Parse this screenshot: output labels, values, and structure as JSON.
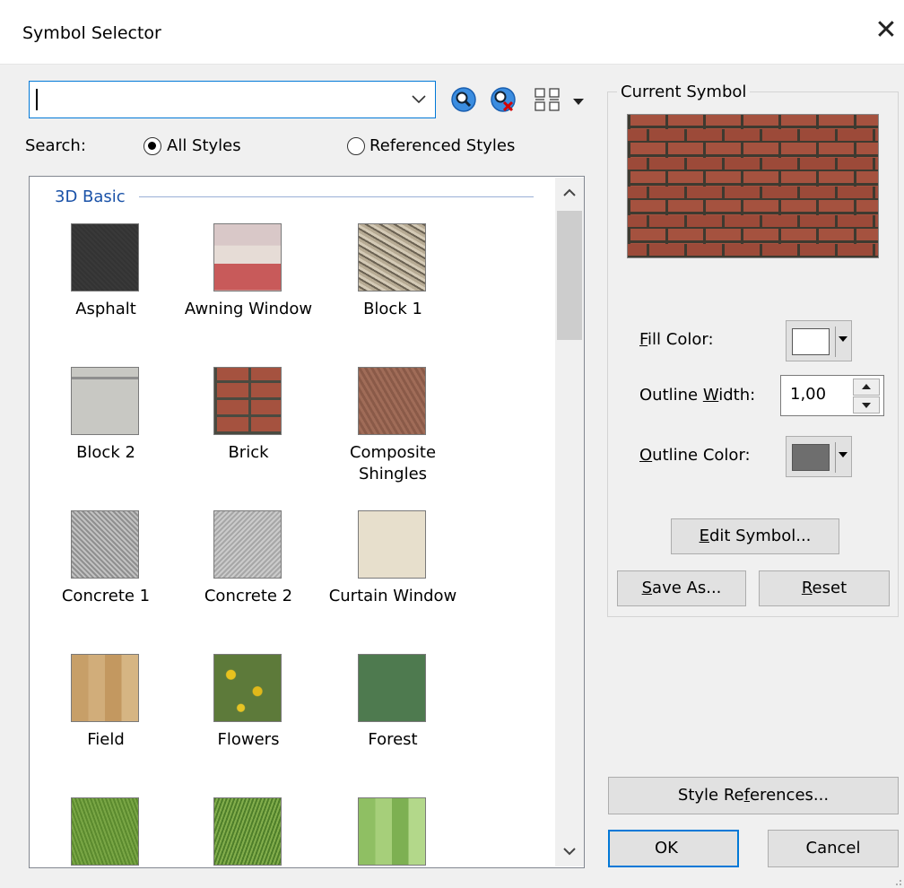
{
  "window": {
    "title": "Symbol Selector",
    "close_glyph": "✕"
  },
  "search": {
    "label": "Search:",
    "value": "",
    "scope_options": [
      {
        "label": "All Styles",
        "selected": true
      },
      {
        "label": "Referenced Styles",
        "selected": false
      }
    ]
  },
  "gallery": {
    "section_title": "3D Basic",
    "items": [
      {
        "label": "Asphalt"
      },
      {
        "label": "Awning Window"
      },
      {
        "label": "Block 1"
      },
      {
        "label": "Block 2"
      },
      {
        "label": "Brick"
      },
      {
        "label": "Composite Shingles"
      },
      {
        "label": "Concrete 1"
      },
      {
        "label": "Concrete 2"
      },
      {
        "label": "Curtain Window"
      },
      {
        "label": "Field"
      },
      {
        "label": "Flowers"
      },
      {
        "label": "Forest"
      },
      {
        "label": ""
      },
      {
        "label": ""
      },
      {
        "label": ""
      }
    ]
  },
  "current_symbol": {
    "group_label": "Current Symbol",
    "fill_color_label": {
      "accel": "F",
      "rest": "ill Color:"
    },
    "fill_color": "#ffffff",
    "outline_width_label": {
      "pre": "Outline ",
      "accel": "W",
      "rest": "idth:"
    },
    "outline_width": "1,00",
    "outline_color_label": {
      "accel": "O",
      "rest": "utline Color:"
    },
    "outline_color": "#6e6e6e",
    "edit_symbol_button": {
      "accel": "E",
      "rest": "dit Symbol..."
    },
    "save_as_button": {
      "accel": "S",
      "rest": "ave As..."
    },
    "reset_button": {
      "accel": "R",
      "rest": "eset"
    }
  },
  "footer": {
    "style_references_button": {
      "pre": "Style Re",
      "accel": "f",
      "rest": "erences..."
    },
    "ok_button": "OK",
    "cancel_button": "Cancel"
  },
  "colors": {
    "accent": "#0078d7",
    "section_title": "#1a52a8",
    "brick": "#a5523f",
    "mortar": "#4a4a40"
  }
}
